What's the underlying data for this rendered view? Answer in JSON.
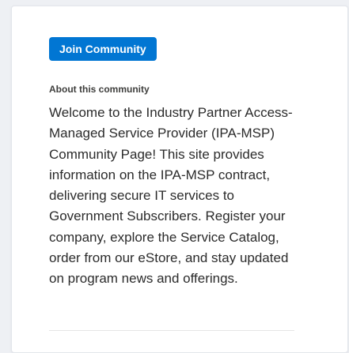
{
  "community": {
    "join_button_label": "Join Community",
    "about_heading": "About this community",
    "about_text": "Welcome to the Industry Partner Access-Managed Service Provider (IPA-MSP) Community Page! This site provides information on the IPA-MSP contract, delivering secure IT services to Government Subscribers. Register your company, explore the Service Catalog, order from our eStore, and stay updated on program news and offerings."
  },
  "colors": {
    "accent": "#0176d3",
    "page_background": "#eef0f4",
    "card_background": "#ffffff"
  }
}
